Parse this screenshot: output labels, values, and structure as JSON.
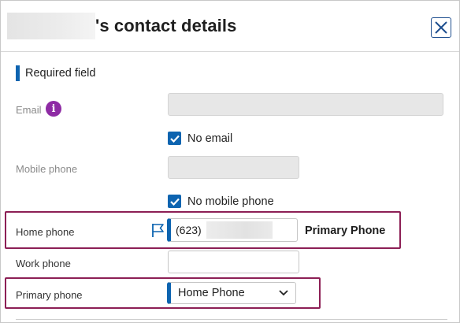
{
  "dialog": {
    "title": "'s contact details",
    "close_icon": "close-icon"
  },
  "required_note": "Required field",
  "email": {
    "label": "Email",
    "info_icon_glyph": "i",
    "value": "",
    "no_email_label": "No email",
    "no_email_checked": true
  },
  "mobile": {
    "label": "Mobile phone",
    "value": "",
    "no_mobile_label": "No mobile phone",
    "no_mobile_checked": true
  },
  "home_phone": {
    "label": "Home phone",
    "value_prefix": "(623)",
    "primary_badge": "Primary Phone",
    "flag_icon": "flag-icon"
  },
  "work_phone": {
    "label": "Work phone",
    "value": ""
  },
  "primary_phone": {
    "label": "Primary phone",
    "selected": "Home Phone"
  },
  "colors": {
    "accent": "#0d64b0",
    "highlight": "#8c1f55",
    "info": "#8e2ba4"
  }
}
